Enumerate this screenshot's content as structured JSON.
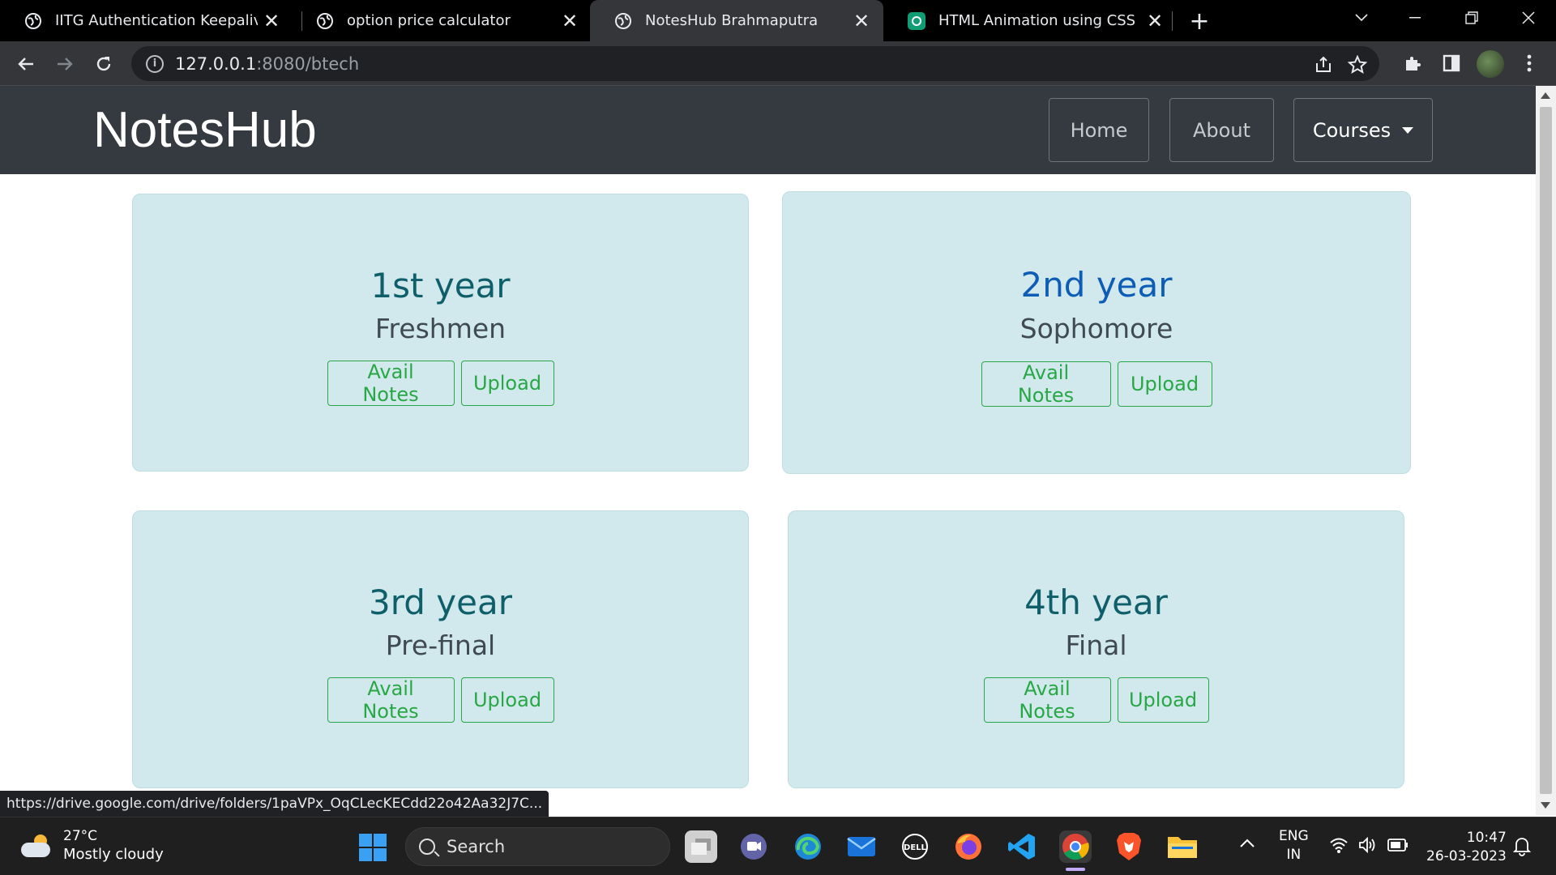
{
  "browser": {
    "tabs": [
      {
        "title": "IITG Authentication Keepalive Wi"
      },
      {
        "title": "option price calculator"
      },
      {
        "title": "NotesHub Brahmaputra"
      },
      {
        "title": "HTML Animation using CSS"
      }
    ],
    "address": {
      "host": "127.0.0.1",
      "path": ":8080/btech"
    },
    "status_url": "https://drive.google.com/drive/folders/1paVPx_OqCLecKECdd22o42Aa32J7C..."
  },
  "site": {
    "brand": "NotesHub",
    "nav": {
      "home": "Home",
      "about": "About",
      "courses": "Courses"
    },
    "cards": [
      {
        "year": "1st year",
        "sub": "Freshmen",
        "avail": "Avail Notes",
        "upload": "Upload"
      },
      {
        "year": "2nd year",
        "sub": "Sophomore",
        "avail": "Avail Notes",
        "upload": "Upload"
      },
      {
        "year": "3rd year",
        "sub": "Pre-final",
        "avail": "Avail Notes",
        "upload": "Upload"
      },
      {
        "year": "4th year",
        "sub": "Final",
        "avail": "Avail Notes",
        "upload": "Upload"
      }
    ]
  },
  "taskbar": {
    "weather": {
      "temp": "27°C",
      "desc": "Mostly cloudy"
    },
    "search": "Search",
    "lang": {
      "line1": "ENG",
      "line2": "IN"
    },
    "clock": {
      "time": "10:47",
      "date": "26-03-2023"
    }
  },
  "colors": {
    "nav_bg": "#343a40",
    "card_bg": "#d1e9ed",
    "btn_green": "#28a745",
    "year_teal": "#0f5f6b",
    "year_blue": "#0d5cb6"
  }
}
